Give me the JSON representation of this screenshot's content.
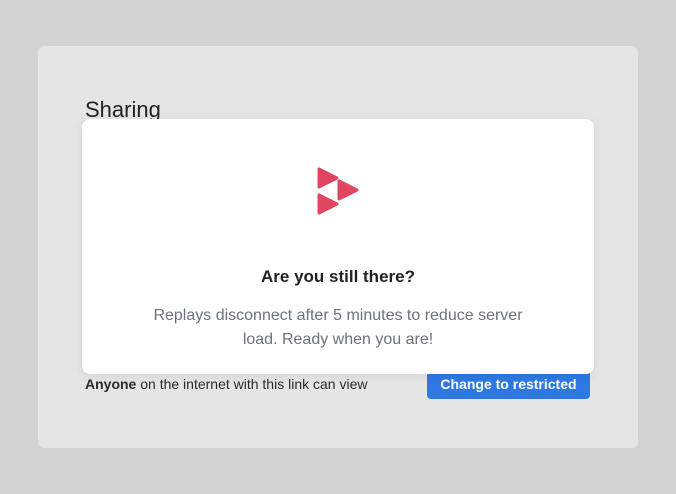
{
  "sharing": {
    "title": "Sharing",
    "access_strong": "Anyone",
    "access_rest": " on the internet with this link can view",
    "change_button_label": "Change to restricted"
  },
  "modal": {
    "logo_icon": "replay-logo-icon",
    "title": "Are you still there?",
    "message": "Replays disconnect after 5 minutes to reduce server load. Ready when you are!"
  },
  "colors": {
    "page_background": "#d2d2d2",
    "panel_background": "#e5e5e5",
    "accent_button": "#2f78e4",
    "logo": "#e0465f",
    "message_text": "#6b7180"
  }
}
